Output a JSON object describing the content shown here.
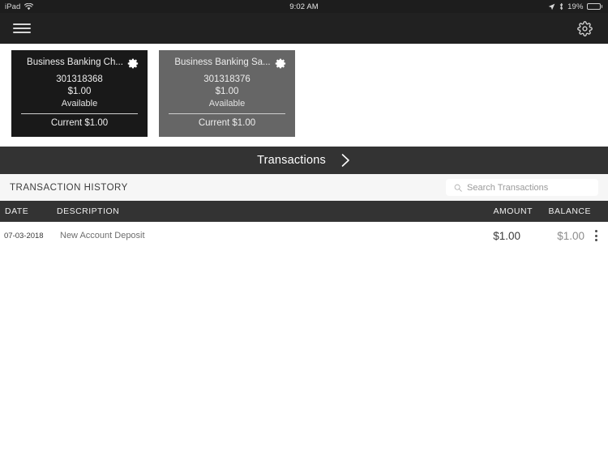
{
  "status_bar": {
    "device_label": "iPad",
    "wifi_icon": "wifi-icon",
    "time": "9:02 AM",
    "location_icon": "location-arrow-icon",
    "bluetooth_icon": "bluetooth-icon",
    "battery_percent": "19%",
    "battery_level": 19
  },
  "navbar": {
    "menu_icon": "hamburger-menu-icon",
    "settings_icon": "gear-icon"
  },
  "accounts": [
    {
      "name": "Business Banking Ch...",
      "number": "301318368",
      "available_amount": "$1.00",
      "available_label": "Available",
      "current_label": "Current $1.00",
      "gear_icon": "gear-icon",
      "selected": true
    },
    {
      "name": "Business Banking Sa...",
      "number": "301318376",
      "available_amount": "$1.00",
      "available_label": "Available",
      "current_label": "Current $1.00",
      "gear_icon": "gear-icon",
      "selected": false
    }
  ],
  "transactions_bar": {
    "label": "Transactions",
    "chevron_icon": "chevron-right-icon"
  },
  "history": {
    "title": "TRANSACTION HISTORY",
    "search": {
      "placeholder": "Search Transactions",
      "value": "",
      "icon": "search-icon"
    },
    "columns": {
      "date": "DATE",
      "description": "DESCRIPTION",
      "amount": "AMOUNT",
      "balance": "BALANCE"
    },
    "rows": [
      {
        "date": "07-03-2018",
        "description": "New Account Deposit",
        "amount": "$1.00",
        "balance": "$1.00",
        "menu_icon": "more-vertical-icon"
      }
    ]
  },
  "colors": {
    "status_bar_bg": "#1d1d1d",
    "navbar_bg": "#212121",
    "card_selected_bg": "#191919",
    "card_unselected_bg": "#666666",
    "section_bar_bg": "#333333",
    "history_header_bg": "#f6f6f6",
    "page_bg": "#ffffff"
  }
}
